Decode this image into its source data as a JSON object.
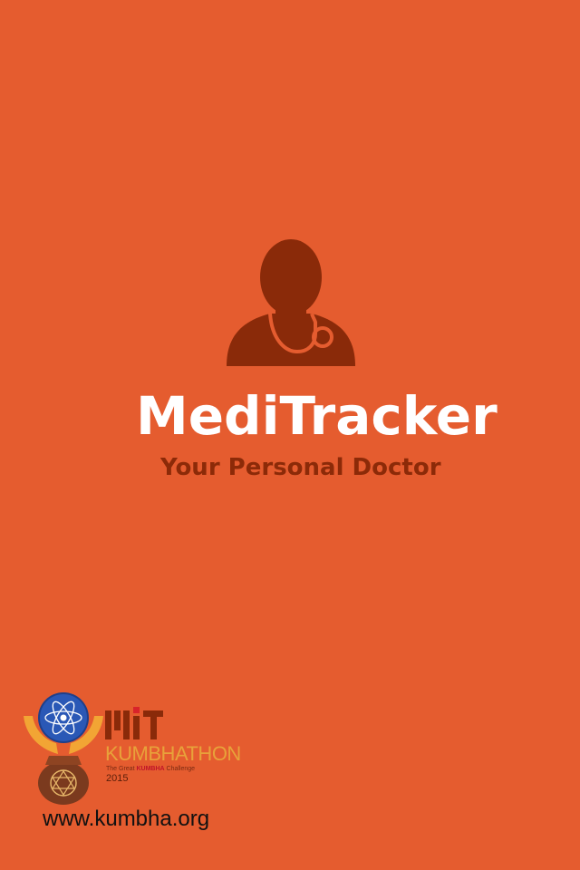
{
  "splash": {
    "app_title": "MediTracker",
    "tagline": "Your Personal Doctor",
    "icon": "doctor-with-stethoscope-icon"
  },
  "sponsor": {
    "emblem_icon": "kumbha-emblem-icon",
    "mit_logo": "mit-logo",
    "event_name": "KUMBHATHON",
    "subtitle_prefix": "The Great ",
    "subtitle_highlight": "KUMBHA",
    "subtitle_suffix": " Challenge",
    "year": "2015",
    "website": "www.kumbha.org"
  },
  "colors": {
    "background": "#E55C2F",
    "icon": "#8A2A09",
    "title": "#FFFFFF",
    "tagline": "#8C2A08"
  }
}
